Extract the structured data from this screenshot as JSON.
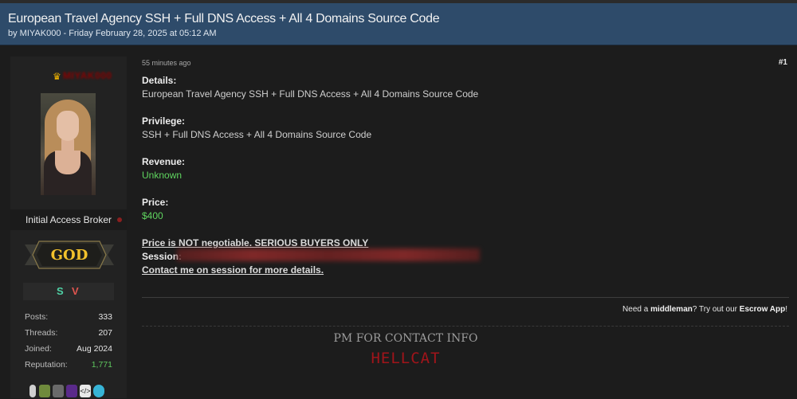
{
  "thread": {
    "title": "European Travel Agency SSH + Full DNS Access + All 4 Domains Source Code",
    "meta": "by MIYAK000 - Friday February 28, 2025 at 05:12 AM"
  },
  "author": {
    "username": "MIYAK000",
    "crown_icon": "crown-icon",
    "rank": "Initial Access Broker",
    "badge": "GOD",
    "tags": [
      "S",
      "V"
    ],
    "stats": [
      {
        "label": "Posts:",
        "value": "333"
      },
      {
        "label": "Threads:",
        "value": "207"
      },
      {
        "label": "Joined:",
        "value": "Aug 2024"
      },
      {
        "label": "Reputation:",
        "value": "1,771"
      }
    ],
    "awards": [
      "award-icon-1",
      "award-icon-2",
      "award-icon-3",
      "award-icon-4",
      "code-icon",
      "award-icon-6"
    ]
  },
  "post": {
    "time": "55 minutes ago",
    "number": "#1",
    "details_label": "Details:",
    "details_value": "European Travel Agency SSH + Full DNS Access + All 4 Domains Source Code",
    "privilege_label": "Privilege:",
    "privilege_value": "SSH + Full DNS Access + All 4 Domains Source Code",
    "revenue_label": "Revenue:",
    "revenue_value": "Unknown",
    "price_label": "Price:",
    "price_value": "$400",
    "negotiable": "Price is NOT negotiable. SERIOUS BUYERS ONLY",
    "session_label": "Session:",
    "contact": "Contact me on session for more details.",
    "escrow_prefix": "Need a ",
    "escrow_mm": "middleman",
    "escrow_mid": "? Try out our ",
    "escrow_app": "Escrow App",
    "escrow_suffix": "!",
    "signature_line": "PM FOR CONTACT INFO",
    "signature_name": "HELLCAT"
  },
  "colors": {
    "header_bg": "#2e4b6a",
    "green_value": "#5fd45f",
    "signature_red": "#a0141a",
    "badge_gold": "#f3c22c"
  }
}
